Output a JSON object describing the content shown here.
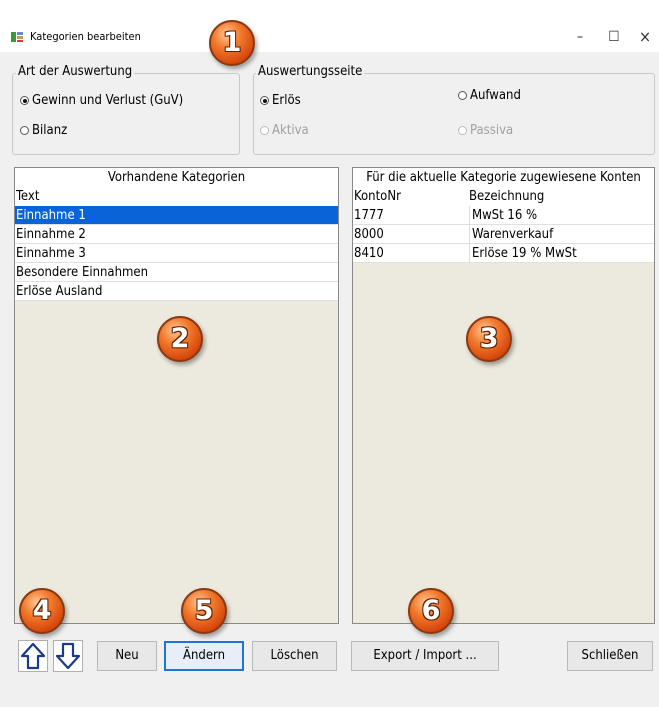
{
  "window": {
    "title": "Kategorien bearbeiten",
    "minimize_glyph": "–",
    "maximize_glyph": "☐",
    "close_glyph": "×"
  },
  "art_der_auswertung": {
    "legend": "Art der Auswertung",
    "options": [
      {
        "label": "Gewinn und Verlust (GuV)",
        "checked": true,
        "disabled": false
      },
      {
        "label": "Bilanz",
        "checked": false,
        "disabled": false
      }
    ]
  },
  "auswertungsseite": {
    "legend": "Auswertungsseite",
    "options": [
      {
        "label": "Erlös",
        "checked": true,
        "disabled": false
      },
      {
        "label": "Aufwand",
        "checked": false,
        "disabled": false
      },
      {
        "label": "Aktiva",
        "checked": false,
        "disabled": true
      },
      {
        "label": "Passiva",
        "checked": false,
        "disabled": true
      }
    ]
  },
  "kategorien": {
    "header": "Vorhandene Kategorien",
    "column": "Text",
    "rows": [
      "Einnahme 1",
      "Einnahme 2",
      "Einnahme 3",
      "Besondere Einnahmen",
      "Erlöse Ausland"
    ],
    "selected_index": 0
  },
  "konten": {
    "header": "Für die aktuelle Kategorie zugewiesene Konten",
    "columns": [
      "KontoNr",
      "Bezeichnung"
    ],
    "rows": [
      {
        "nr": "1777",
        "bez": "MwSt 16 %"
      },
      {
        "nr": "8000",
        "bez": "Warenverkauf"
      },
      {
        "nr": "8410",
        "bez": "Erlöse 19 % MwSt"
      }
    ]
  },
  "buttons": {
    "neu": "Neu",
    "aendern": "Ändern",
    "loeschen": "Löschen",
    "export_import": "Export / Import ...",
    "schliessen": "Schließen"
  },
  "callouts": [
    "1",
    "2",
    "3",
    "4",
    "5",
    "6"
  ],
  "colors": {
    "selection": "#0a64d8",
    "panel_background": "#ece9de",
    "callout": "#e8601c"
  }
}
